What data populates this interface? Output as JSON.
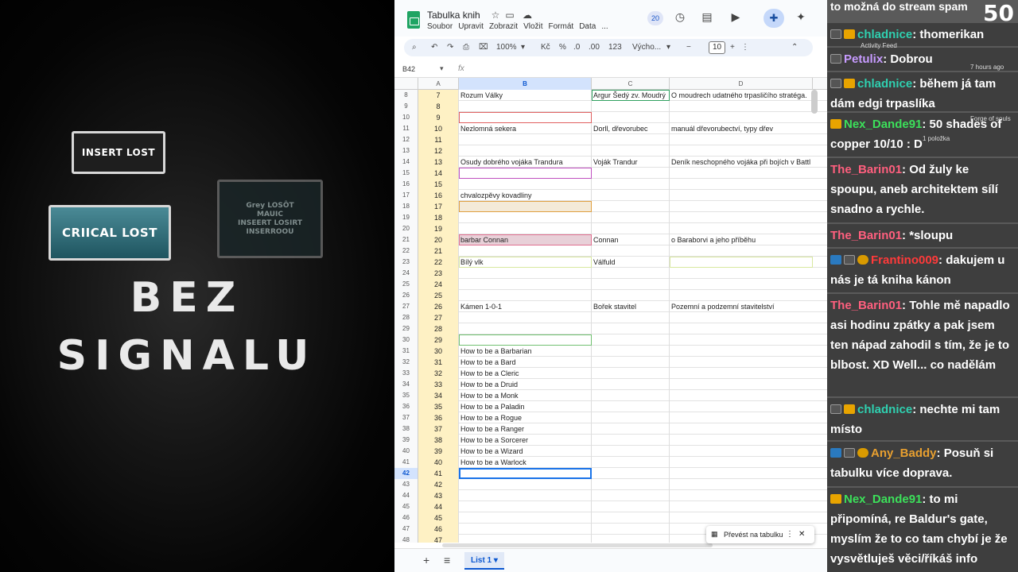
{
  "left": {
    "card1": "INSERT LOST",
    "card2": "CRIICAL LOST",
    "card3": "Grey LOSÔT\nMAUIC\nINSEERT LOSIRT\nINSERROOU",
    "title_line1": "BEZ",
    "title_line2": "SIGNALU"
  },
  "sheet": {
    "title": "Tabulka knih",
    "menu": [
      "Soubor",
      "Upravit",
      "Zobrazit",
      "Vložit",
      "Formát",
      "Data",
      "..."
    ],
    "badge_count": "20",
    "toolbar": {
      "zoom": "100%",
      "currency": "Kč",
      "percent": "%",
      "dec_less": ".0",
      "dec_more": ".00",
      "num_format": "123",
      "font": "Výcho...",
      "font_size": "10"
    },
    "name_box": "B42",
    "fx": "fx",
    "columns": [
      "A",
      "B",
      "C",
      "D"
    ],
    "rows": [
      {
        "n": "8",
        "a": "7",
        "b": "Rozum Války",
        "c": "Argur Šedý zv. Moudrý",
        "d": "O moudrech udatného trpasličího stratéga."
      },
      {
        "n": "9",
        "a": "8",
        "b": "",
        "c": "",
        "d": ""
      },
      {
        "n": "10",
        "a": "9",
        "b": "",
        "c": "",
        "d": ""
      },
      {
        "n": "11",
        "a": "10",
        "b": "Nezlomná sekera",
        "c": "Dorll, dřevorubec",
        "d": "manuál dřevorubectví, typy dřev"
      },
      {
        "n": "12",
        "a": "11",
        "b": "",
        "c": "",
        "d": ""
      },
      {
        "n": "13",
        "a": "12",
        "b": "",
        "c": "",
        "d": ""
      },
      {
        "n": "14",
        "a": "13",
        "b": "Osudy dobrého vojáka Trandura",
        "c": "Voják Trandur",
        "d": "Deník neschopného vojáka při bojích v Battl"
      },
      {
        "n": "15",
        "a": "14",
        "b": "",
        "c": "",
        "d": ""
      },
      {
        "n": "16",
        "a": "15",
        "b": "",
        "c": "",
        "d": ""
      },
      {
        "n": "17",
        "a": "16",
        "b": "chvalozpěvy kovadliny",
        "c": "",
        "d": ""
      },
      {
        "n": "18",
        "a": "17",
        "b": "",
        "c": "",
        "d": ""
      },
      {
        "n": "19",
        "a": "18",
        "b": "",
        "c": "",
        "d": ""
      },
      {
        "n": "20",
        "a": "19",
        "b": "",
        "c": "",
        "d": ""
      },
      {
        "n": "21",
        "a": "20",
        "b": "barbar Connan",
        "c": "Connan",
        "d": "o Baraborvi a jeho příběhu"
      },
      {
        "n": "22",
        "a": "21",
        "b": "",
        "c": "",
        "d": ""
      },
      {
        "n": "23",
        "a": "22",
        "b": "Bílý vlk",
        "c": "Válfuld",
        "d": ""
      },
      {
        "n": "24",
        "a": "23",
        "b": "",
        "c": "",
        "d": ""
      },
      {
        "n": "25",
        "a": "24",
        "b": "",
        "c": "",
        "d": ""
      },
      {
        "n": "26",
        "a": "25",
        "b": "",
        "c": "",
        "d": ""
      },
      {
        "n": "27",
        "a": "26",
        "b": "Kámen 1-0-1",
        "c": "Bořek stavitel",
        "d": "Pozemní a podzemní stavitelství"
      },
      {
        "n": "28",
        "a": "27",
        "b": "",
        "c": "",
        "d": ""
      },
      {
        "n": "29",
        "a": "28",
        "b": "",
        "c": "",
        "d": ""
      },
      {
        "n": "30",
        "a": "29",
        "b": "",
        "c": "",
        "d": ""
      },
      {
        "n": "31",
        "a": "30",
        "b": "How to be a Barbarian",
        "c": "",
        "d": ""
      },
      {
        "n": "32",
        "a": "31",
        "b": "How to be a Bard",
        "c": "",
        "d": ""
      },
      {
        "n": "33",
        "a": "32",
        "b": "How to be a Cleric",
        "c": "",
        "d": ""
      },
      {
        "n": "34",
        "a": "33",
        "b": "How to be a Druid",
        "c": "",
        "d": ""
      },
      {
        "n": "35",
        "a": "34",
        "b": "How to be a Monk",
        "c": "",
        "d": ""
      },
      {
        "n": "36",
        "a": "35",
        "b": "How to be a Paladin",
        "c": "",
        "d": ""
      },
      {
        "n": "37",
        "a": "36",
        "b": "How to be a Rogue",
        "c": "",
        "d": ""
      },
      {
        "n": "38",
        "a": "37",
        "b": "How to be a Ranger",
        "c": "",
        "d": ""
      },
      {
        "n": "39",
        "a": "38",
        "b": "How to be a Sorcerer",
        "c": "",
        "d": ""
      },
      {
        "n": "40",
        "a": "39",
        "b": "How to be a Wizard",
        "c": "",
        "d": ""
      },
      {
        "n": "41",
        "a": "40",
        "b": "How to be a Warlock",
        "c": "",
        "d": ""
      },
      {
        "n": "42",
        "a": "41",
        "b": "",
        "c": "",
        "d": ""
      },
      {
        "n": "43",
        "a": "42",
        "b": "",
        "c": "",
        "d": ""
      },
      {
        "n": "44",
        "a": "43",
        "b": "",
        "c": "",
        "d": ""
      },
      {
        "n": "45",
        "a": "44",
        "b": "",
        "c": "",
        "d": ""
      },
      {
        "n": "46",
        "a": "45",
        "b": "",
        "c": "",
        "d": ""
      },
      {
        "n": "47",
        "a": "46",
        "b": "",
        "c": "",
        "d": ""
      },
      {
        "n": "48",
        "a": "47",
        "b": "",
        "c": "",
        "d": ""
      }
    ],
    "sheet_tab": "List 1",
    "toast": "Převést na tabulku"
  },
  "chat": {
    "top_text": "to možná do stream spam",
    "viewer_count": "50",
    "overlay_activity": "Activity Feed",
    "overlay_time": "7 hours ago",
    "overlay_forge": "Forge of souls",
    "overlay_items": "1 položka",
    "messages": [
      {
        "name": "chladnice",
        "color": "#2fd0b0",
        "text": ": thomerikan"
      },
      {
        "name": "Petulix",
        "color": "#c79bff",
        "text": ": Dobrou"
      },
      {
        "name": "chladnice",
        "color": "#2fd0b0",
        "text": ": během já tam dám edgi trpaslíka"
      },
      {
        "name": "Nex_Dande91",
        "color": "#3ce05a",
        "text": ": 50 shades of copper 10/10 : D"
      },
      {
        "name": "The_Barin01",
        "color": "#ff5f7e",
        "text": ": Od žuly ke spoupu, aneb architektem sílí snadno a rychle."
      },
      {
        "name": "The_Barin01",
        "color": "#ff5f7e",
        "text": ": *sloupu"
      },
      {
        "name": "Frantino009",
        "color": "#ff3a3a",
        "text": ": dakujem u nás je tá kniha kánon"
      },
      {
        "name": "The_Barin01",
        "color": "#ff5f7e",
        "text": ": Tohle mě napadlo asi hodinu zpátky a pak jsem ten nápad zahodil s tím, že je to blbost. XD Well... co nadělám"
      },
      {
        "name": "chladnice",
        "color": "#2fd0b0",
        "text": ": nechte mi tam místo"
      },
      {
        "name": "Any_Baddy",
        "color": "#e8a030",
        "text": ": Posuň si tabulku více doprava."
      },
      {
        "name": "Nex_Dande91",
        "color": "#3ce05a",
        "text": ": to mi připomíná, re Baldur's gate, myslím že to co tam chybí je že vysvětluješ věci/říkáš info"
      }
    ]
  }
}
